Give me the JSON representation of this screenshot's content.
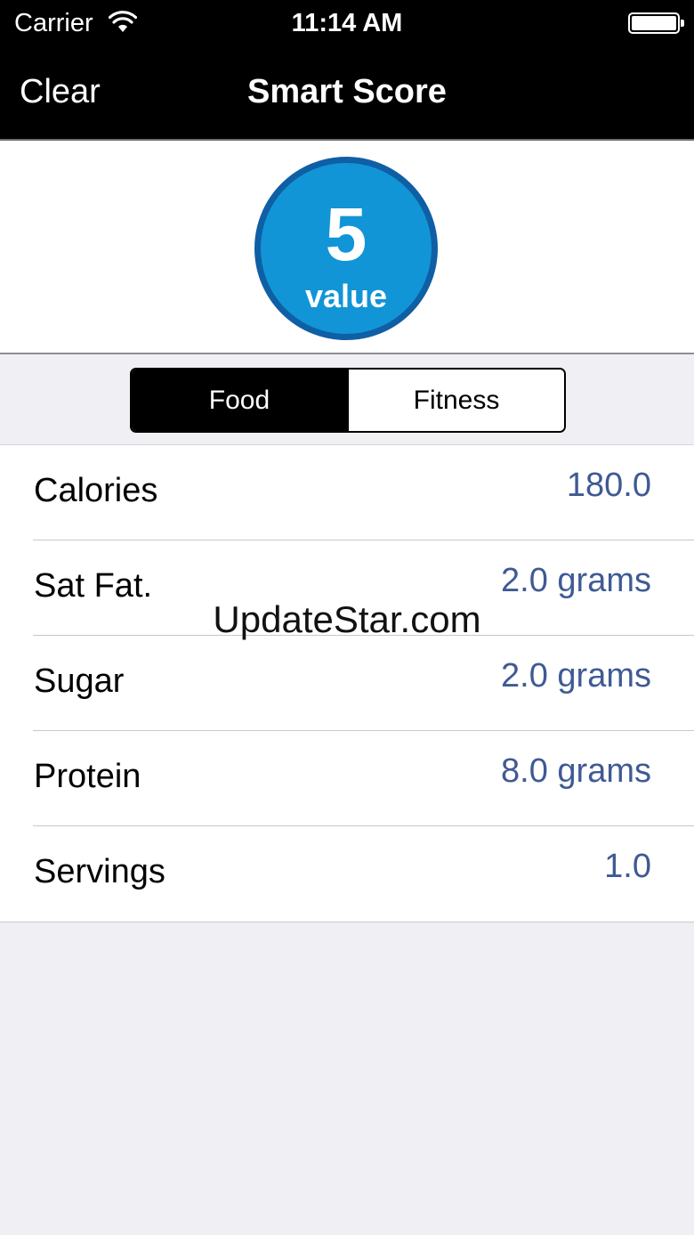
{
  "status_bar": {
    "carrier": "Carrier",
    "time": "11:14 AM"
  },
  "nav": {
    "clear_label": "Clear",
    "title": "Smart Score"
  },
  "score": {
    "value": "5",
    "label": "value",
    "colors": {
      "fill": "#1195d6",
      "ring": "#0f5fa5"
    }
  },
  "segments": {
    "items": [
      "Food",
      "Fitness"
    ],
    "selected": "Food"
  },
  "nutrition": {
    "rows": [
      {
        "label": "Calories",
        "value": "180.0"
      },
      {
        "label": "Sat Fat.",
        "value": "2.0 grams"
      },
      {
        "label": "Sugar",
        "value": "2.0 grams"
      },
      {
        "label": "Protein",
        "value": "8.0 grams"
      },
      {
        "label": "Servings",
        "value": "1.0"
      }
    ],
    "value_color": "#3f5a94"
  },
  "watermark": "UpdateStar.com"
}
